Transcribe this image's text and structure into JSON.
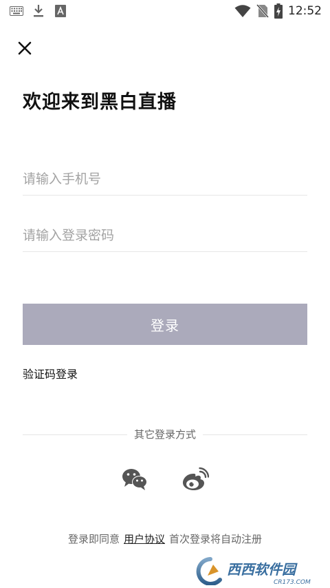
{
  "status_bar": {
    "time": "12:52",
    "left_icons": [
      "keyboard-icon",
      "download-icon",
      "text-a-icon"
    ],
    "right_icons": [
      "wifi-icon",
      "no-sim-icon",
      "battery-charging-icon"
    ]
  },
  "header": {
    "close_icon": "close-icon",
    "title": "欢迎来到黑白直播"
  },
  "form": {
    "phone_placeholder": "请输入手机号",
    "phone_value": "",
    "password_placeholder": "请输入登录密码",
    "password_value": "",
    "login_label": "登录",
    "sms_login_label": "验证码登录"
  },
  "other_login": {
    "label": "其它登录方式",
    "providers": [
      "wechat-icon",
      "weibo-icon"
    ]
  },
  "agreement": {
    "prefix": "登录即同意",
    "link": "用户协议",
    "suffix": "首次登录将自动注册"
  },
  "watermark": {
    "logo_text": "西西软件园",
    "url_text": "CR173.COM"
  },
  "colors": {
    "login_button": "#abaabb",
    "placeholder": "#a3a3a3",
    "divider": "#e5e5e5",
    "icon_gray": "#555555"
  }
}
